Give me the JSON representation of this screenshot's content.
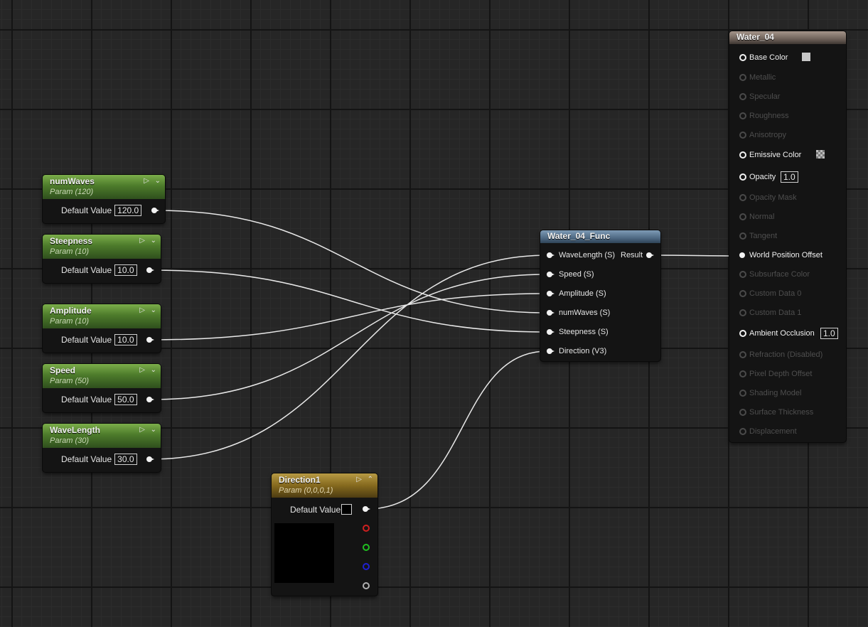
{
  "params": [
    {
      "id": "numWaves",
      "title": "numWaves",
      "subtitle": "Param (120)",
      "label": "Default Value",
      "value": "120.0"
    },
    {
      "id": "steepness",
      "title": "Steepness",
      "subtitle": "Param (10)",
      "label": "Default Value",
      "value": "10.0"
    },
    {
      "id": "amplitude",
      "title": "Amplitude",
      "subtitle": "Param (10)",
      "label": "Default Value",
      "value": "10.0"
    },
    {
      "id": "speed",
      "title": "Speed",
      "subtitle": "Param (50)",
      "label": "Default Value",
      "value": "50.0"
    },
    {
      "id": "wavelength",
      "title": "WaveLength",
      "subtitle": "Param (30)",
      "label": "Default Value",
      "value": "30.0"
    }
  ],
  "direction": {
    "title": "Direction1",
    "subtitle": "Param (0,0,0,1)",
    "label": "Default Value",
    "preview_color": "#000000",
    "channel_colors": [
      "#d02020",
      "#20c020",
      "#2020d0",
      "#b0b0b0"
    ]
  },
  "func": {
    "title": "Water_04_Func",
    "inputs": [
      "WaveLength (S)",
      "Speed (S)",
      "Amplitude (S)",
      "numWaves (S)",
      "Steepness (S)",
      "Direction (V3)"
    ],
    "output": "Result"
  },
  "material": {
    "title": "Water_04",
    "pins": [
      {
        "label": "Base Color",
        "active": true,
        "value_type": "color",
        "color": "#c8c8c8"
      },
      {
        "label": "Metallic",
        "active": false
      },
      {
        "label": "Specular",
        "active": false
      },
      {
        "label": "Roughness",
        "active": false
      },
      {
        "label": "Anisotropy",
        "active": false
      },
      {
        "label": "Emissive Color",
        "active": true,
        "value_type": "checker"
      },
      {
        "label": "Opacity",
        "active": true,
        "value_type": "number",
        "value": "1.0"
      },
      {
        "label": "Opacity Mask",
        "active": false
      },
      {
        "label": "Normal",
        "active": false
      },
      {
        "label": "Tangent",
        "active": false
      },
      {
        "label": "World Position Offset",
        "active": true
      },
      {
        "label": "Subsurface Color",
        "active": false
      },
      {
        "label": "Custom Data 0",
        "active": false
      },
      {
        "label": "Custom Data 1",
        "active": false
      },
      {
        "label": "Ambient Occlusion",
        "active": true,
        "value_type": "number",
        "value": "1.0"
      },
      {
        "label": "Refraction (Disabled)",
        "active": false
      },
      {
        "label": "Pixel Depth Offset",
        "active": false
      },
      {
        "label": "Shading Model",
        "active": false
      },
      {
        "label": "Surface Thickness",
        "active": false
      },
      {
        "label": "Displacement",
        "active": false
      }
    ]
  },
  "connections": [
    {
      "from": "numWaves",
      "to": "numWaves (S)"
    },
    {
      "from": "Steepness",
      "to": "Steepness (S)"
    },
    {
      "from": "Amplitude",
      "to": "Amplitude (S)"
    },
    {
      "from": "Speed",
      "to": "Speed (S)"
    },
    {
      "from": "WaveLength",
      "to": "WaveLength (S)"
    },
    {
      "from": "Direction1",
      "to": "Direction (V3)"
    },
    {
      "from": "Result",
      "to": "World Position Offset"
    }
  ]
}
